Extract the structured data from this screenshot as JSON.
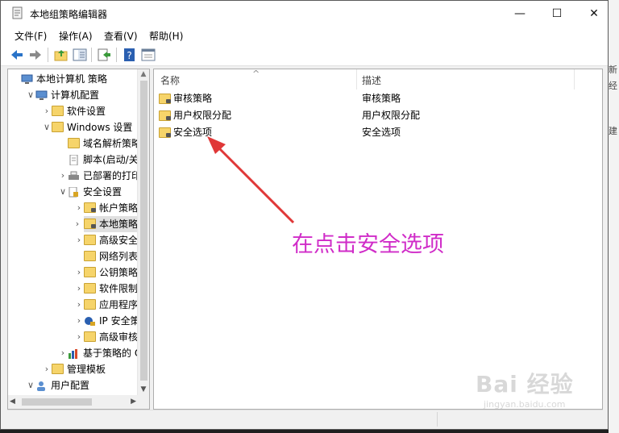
{
  "window": {
    "title": "本地组策略编辑器",
    "minimize_glyph": "—",
    "maximize_glyph": "☐",
    "close_glyph": "✕"
  },
  "menu": [
    "文件(F)",
    "操作(A)",
    "查看(V)",
    "帮助(H)"
  ],
  "toolbar": {
    "buttons": [
      "back-arrow-icon",
      "forward-arrow-icon",
      "up-folder-icon",
      "show-tree-icon",
      "export-list-icon",
      "help-icon",
      "properties-icon"
    ]
  },
  "tree": {
    "items": [
      {
        "label": "本地计算机 策略",
        "arrow": "",
        "icon": "computer-policy-icon",
        "level": 0
      },
      {
        "label": "计算机配置",
        "arrow": "∨",
        "icon": "computer-icon",
        "level": 1
      },
      {
        "label": "软件设置",
        "arrow": "›",
        "icon": "folder-icon",
        "level": 2
      },
      {
        "label": "Windows 设置",
        "arrow": "∨",
        "icon": "folder-icon",
        "level": 2
      },
      {
        "label": "域名解析策略",
        "arrow": "",
        "icon": "folder-icon",
        "level": 3
      },
      {
        "label": "脚本(启动/关机)",
        "arrow": "",
        "icon": "script-icon",
        "level": 3
      },
      {
        "label": "已部署的打印机",
        "arrow": "›",
        "icon": "printer-icon",
        "level": 3
      },
      {
        "label": "安全设置",
        "arrow": "∨",
        "icon": "security-settings-icon",
        "level": 3
      },
      {
        "label": "帐户策略",
        "arrow": "›",
        "icon": "locked-folder-icon",
        "level": 4
      },
      {
        "label": "本地策略",
        "arrow": "›",
        "icon": "locked-folder-icon",
        "level": 4,
        "selected": true
      },
      {
        "label": "高级安全 Windows",
        "arrow": "›",
        "icon": "folder-icon",
        "level": 4
      },
      {
        "label": "网络列表管理器",
        "arrow": "",
        "icon": "folder-icon",
        "level": 4
      },
      {
        "label": "公钥策略",
        "arrow": "›",
        "icon": "folder-icon",
        "level": 4
      },
      {
        "label": "软件限制策略",
        "arrow": "›",
        "icon": "folder-icon",
        "level": 4
      },
      {
        "label": "应用程序控制",
        "arrow": "›",
        "icon": "folder-icon",
        "level": 4
      },
      {
        "label": "IP 安全策略",
        "arrow": "›",
        "icon": "ip-security-icon",
        "level": 4
      },
      {
        "label": "高级审核策略",
        "arrow": "›",
        "icon": "folder-icon",
        "level": 4
      },
      {
        "label": "基于策略的 QoS",
        "arrow": "›",
        "icon": "chart-icon",
        "level": 3
      },
      {
        "label": "管理模板",
        "arrow": "›",
        "icon": "folder-icon",
        "level": 2
      },
      {
        "label": "用户配置",
        "arrow": "∨",
        "icon": "user-icon",
        "level": 1
      }
    ]
  },
  "list": {
    "columns": [
      "名称",
      "描述"
    ],
    "sort_glyph": "^",
    "rows": [
      {
        "name": "审核策略",
        "desc": "审核策略"
      },
      {
        "name": "用户权限分配",
        "desc": "用户权限分配"
      },
      {
        "name": "安全选项",
        "desc": "安全选项"
      }
    ]
  },
  "annotation": {
    "text": "在点击安全选项",
    "color": "#d02cc8"
  },
  "watermark": {
    "brand": "Bai 经验",
    "url": "jingyan.baidu.com"
  },
  "background_strip": [
    "新",
    "经",
    "建"
  ],
  "colors": {
    "folder": "#f6d46a",
    "selection": "#e0e0e0",
    "arrow": "#e03838",
    "accent_blue": "#2a73c8"
  }
}
